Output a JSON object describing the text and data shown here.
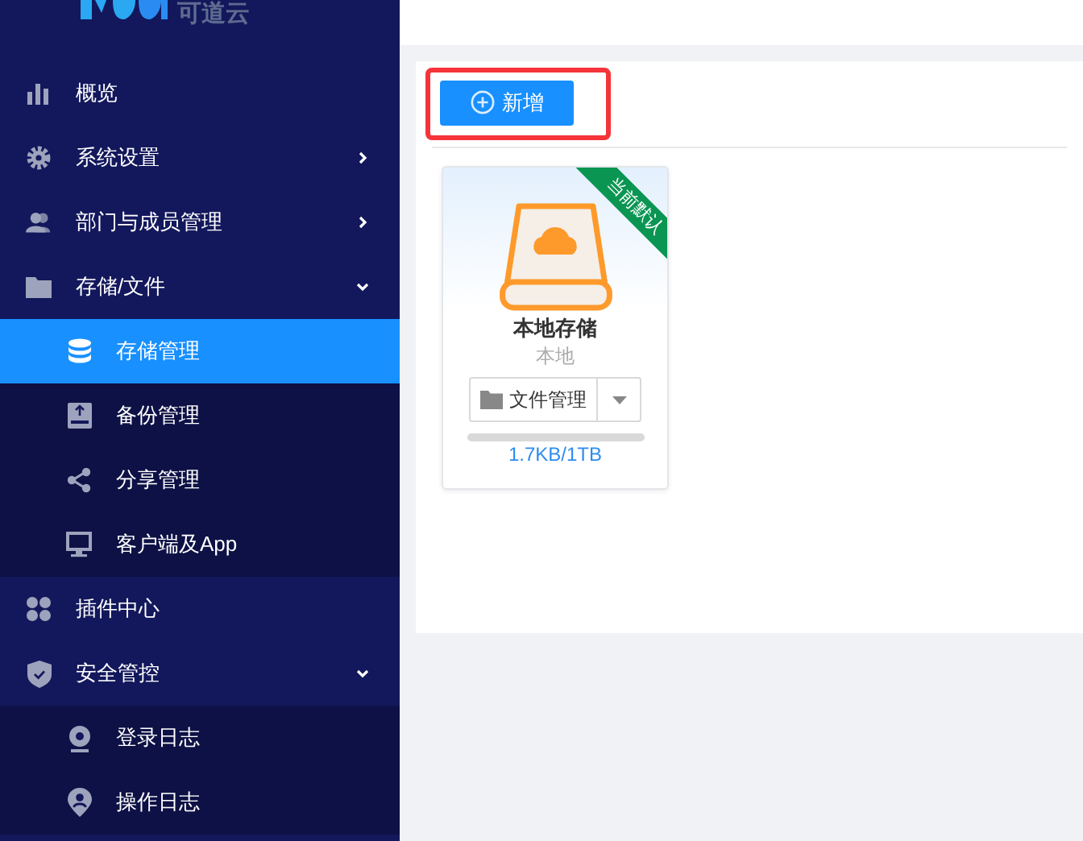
{
  "logo": {
    "text": "可道云"
  },
  "sidebar": {
    "items": [
      {
        "label": "概览"
      },
      {
        "label": "系统设置",
        "expanded": false
      },
      {
        "label": "部门与成员管理",
        "expanded": false
      },
      {
        "label": "存储/文件",
        "expanded": true,
        "children": [
          {
            "label": "存储管理",
            "selected": true
          },
          {
            "label": "备份管理",
            "selected": false
          },
          {
            "label": "分享管理",
            "selected": false
          },
          {
            "label": "客户端及App",
            "selected": false
          }
        ]
      },
      {
        "label": "插件中心"
      },
      {
        "label": "安全管控",
        "expanded": true,
        "children": [
          {
            "label": "登录日志",
            "selected": false
          },
          {
            "label": "操作日志",
            "selected": false
          }
        ]
      }
    ]
  },
  "toolbar": {
    "add_button": "新增",
    "highlighted": true
  },
  "storages": [
    {
      "name": "本地存储",
      "type": "本地",
      "badge": "当前默认",
      "action": "文件管理",
      "reading": "1.7KB/1TB"
    }
  ]
}
